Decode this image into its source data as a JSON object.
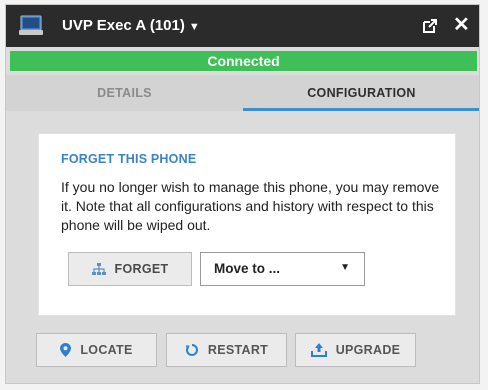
{
  "window": {
    "title": "UVP Exec A (101)",
    "caret": "▼",
    "close": "✕",
    "icons": [
      "phone-icon",
      "popout-icon",
      "close-icon"
    ]
  },
  "status": {
    "text": "Connected",
    "color": "#3fbf57"
  },
  "tabs": [
    {
      "label": "DETAILS",
      "active": false
    },
    {
      "label": "CONFIGURATION",
      "active": true
    }
  ],
  "forget_card": {
    "heading": "FORGET THIS PHONE",
    "body": "If you no longer wish to manage this phone, you may remove it. Note that all configurations and history with respect to this phone will be wiped out.",
    "forget_button": "FORGET",
    "move_select": {
      "value": "Move to ...",
      "caret": "▼"
    }
  },
  "actions": [
    {
      "label": "LOCATE",
      "icon": "location-pin-icon"
    },
    {
      "label": "RESTART",
      "icon": "restart-icon"
    },
    {
      "label": "UPGRADE",
      "icon": "upgrade-icon"
    }
  ],
  "colors": {
    "accent": "#3a8fd2",
    "heading": "#3a83c6",
    "titlebar": "#2b2b2b"
  }
}
